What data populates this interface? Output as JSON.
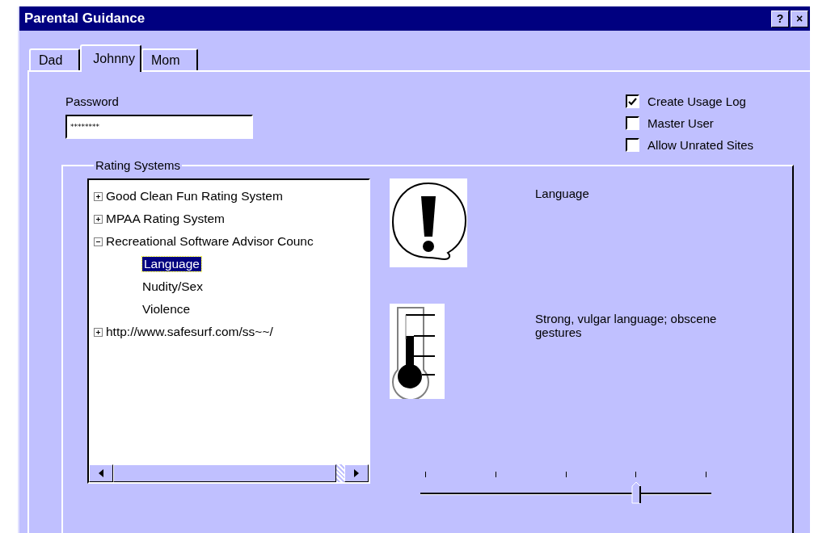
{
  "window": {
    "title": "Parental Guidance",
    "buttons": [
      "?",
      "×"
    ]
  },
  "tabs": [
    {
      "label": "Dad",
      "selected": false
    },
    {
      "label": "Johnny",
      "selected": true
    },
    {
      "label": "Mom",
      "selected": false
    }
  ],
  "password": {
    "label": "Password",
    "value": "********"
  },
  "options": [
    {
      "label": "Create Usage Log",
      "checked": true
    },
    {
      "label": "Master User",
      "checked": false
    },
    {
      "label": "Allow Unrated Sites",
      "checked": false
    }
  ],
  "rating_systems": {
    "title": "Rating Systems",
    "tree": [
      {
        "label": "Good Clean Fun Rating System",
        "expanded": false,
        "selected": false
      },
      {
        "label": "MPAA Rating System",
        "expanded": false,
        "selected": false
      },
      {
        "label": "Recreational Software Advisor Counc",
        "expanded": true,
        "selected": false,
        "children": [
          {
            "label": "Language",
            "selected": true
          },
          {
            "label": "Nudity/Sex",
            "selected": false
          },
          {
            "label": "Violence",
            "selected": false
          }
        ]
      },
      {
        "label": "http://www.safesurf.com/ss~~/",
        "expanded": false,
        "selected": false
      }
    ],
    "category": "Language",
    "description": "Strong, vulgar language; obscene gestures",
    "slider": {
      "level": 0.75
    }
  }
}
